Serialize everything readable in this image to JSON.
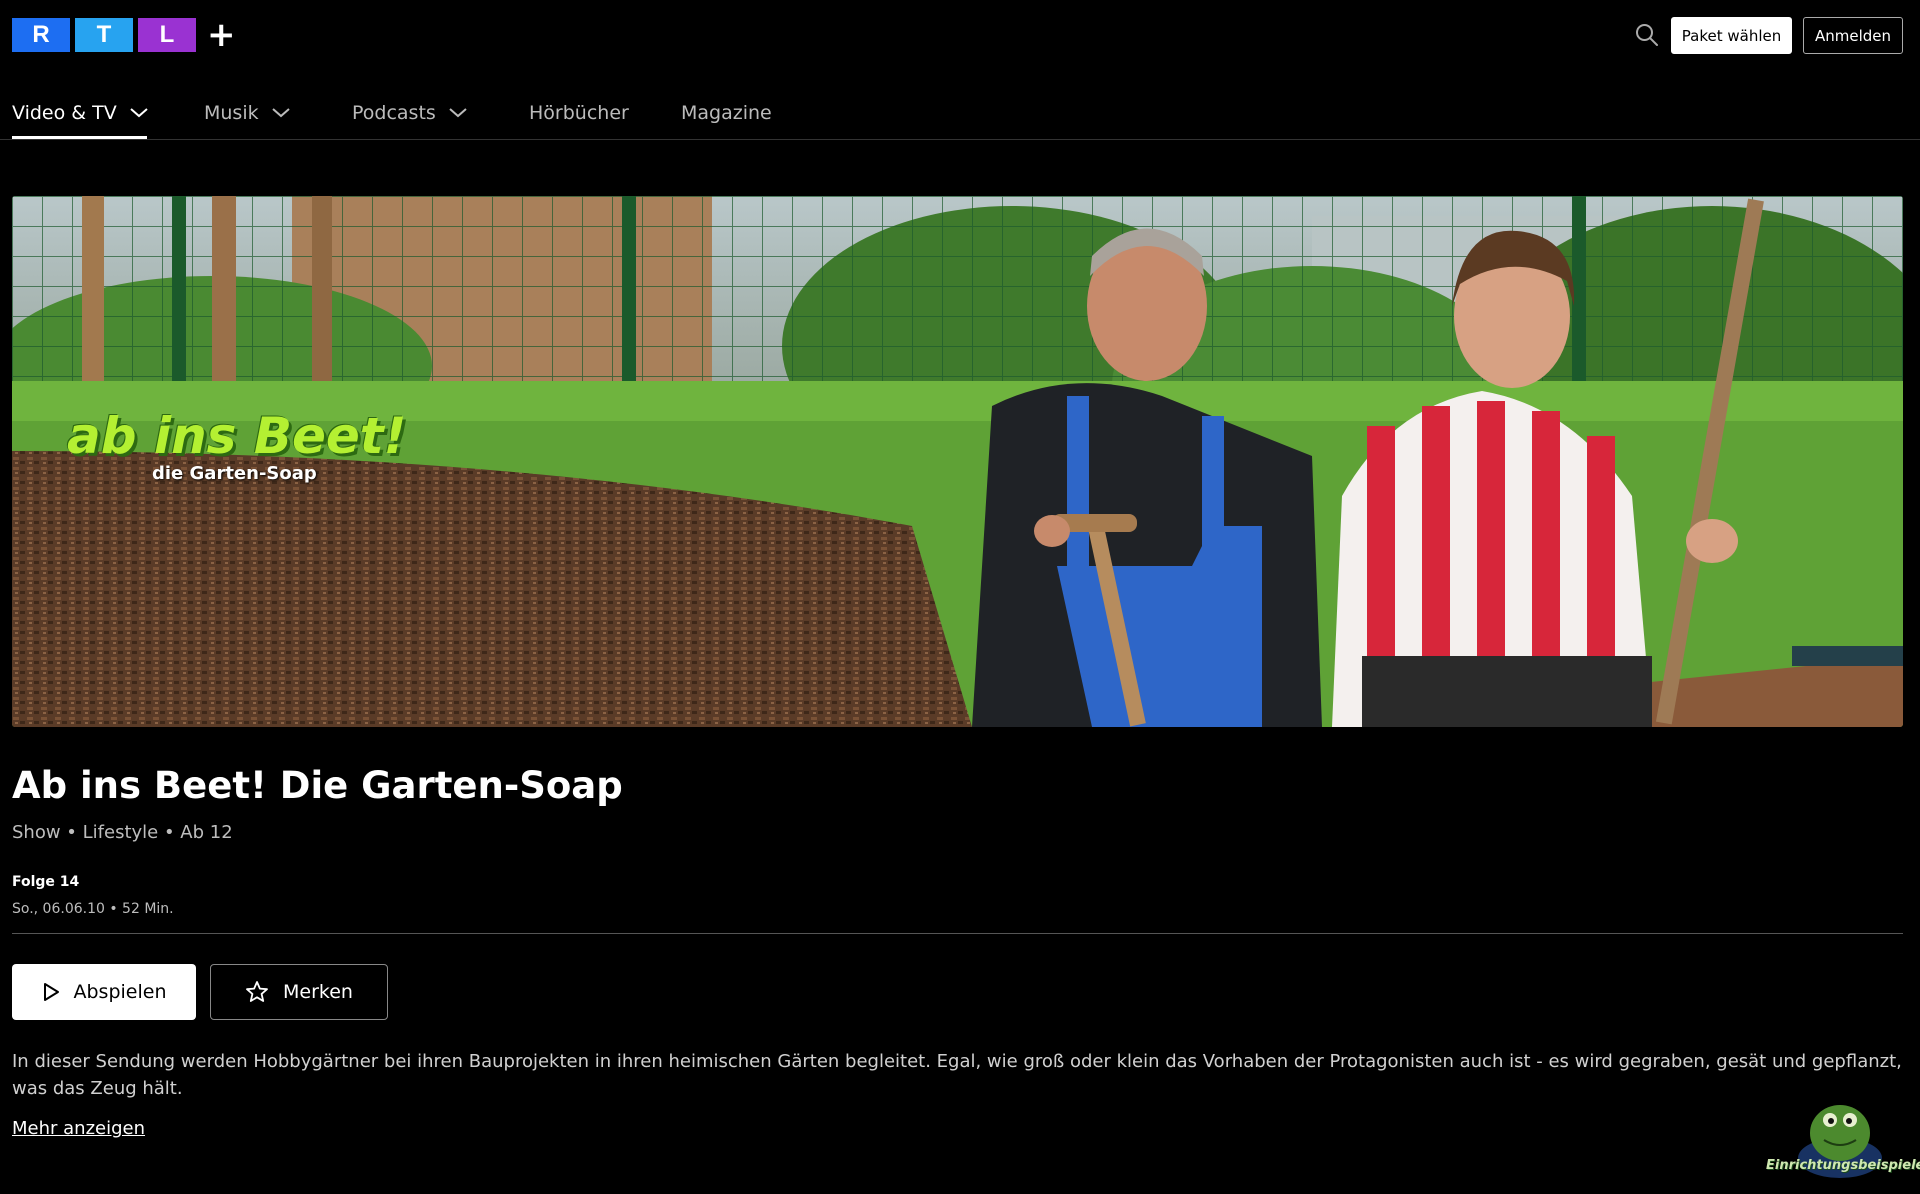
{
  "header": {
    "logo_letters": [
      "R",
      "T",
      "L"
    ],
    "logo_colors": [
      "#1d6ef2",
      "#27a3f0",
      "#9a32d2"
    ],
    "package_button": "Paket wählen",
    "login_button": "Anmelden",
    "search_icon": "search-icon"
  },
  "nav": {
    "items": [
      {
        "label": "Video & TV",
        "has_dropdown": true,
        "active": true
      },
      {
        "label": "Musik",
        "has_dropdown": true,
        "active": false
      },
      {
        "label": "Podcasts",
        "has_dropdown": true,
        "active": false
      },
      {
        "label": "Hörbücher",
        "has_dropdown": false,
        "active": false
      },
      {
        "label": "Magazine",
        "has_dropdown": false,
        "active": false
      }
    ]
  },
  "hero": {
    "show_logo_main": "ab ins Beet!",
    "show_logo_sub": "die Garten-Soap"
  },
  "show": {
    "title": "Ab ins Beet! Die Garten-Soap",
    "meta": "Show • Lifestyle • Ab 12",
    "episode_label": "Folge 14",
    "episode_meta": "So., 06.06.10 • 52 Min.",
    "play_button": "Abspielen",
    "watchlist_button": "Merken",
    "description": "In dieser Sendung werden Hobbygärtner bei ihren Bauprojekten in ihren heimischen Gärten begleitet. Egal, wie groß oder klein das Vorhaben der Protagonisten auch ist - es wird gegraben, gesät und gepflanzt, was das Zeug hält.",
    "more_link": "Mehr anzeigen"
  },
  "watermark": {
    "text": "Einrichtungsbeispiele"
  }
}
